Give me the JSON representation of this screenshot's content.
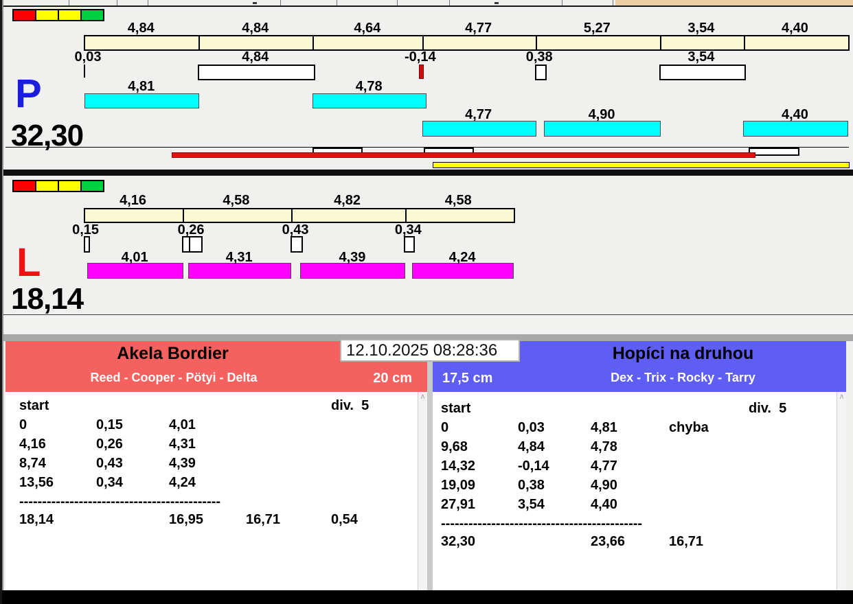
{
  "clock": {
    "datetime": "12.10.2025 08:28:36"
  },
  "race_panels": [
    {
      "letter": "P",
      "letter_color": "#1c1cdc",
      "total": "32,30",
      "traffic_colors": [
        "#ff0000",
        "#ffff00",
        "#ffff00",
        "#00cf3f"
      ],
      "bar_color": "#00ffff",
      "segments": [
        {
          "label": "4,84",
          "value": 4.84
        },
        {
          "label": "4,84",
          "value": 4.84
        },
        {
          "label": "4,64",
          "value": 4.64
        },
        {
          "label": "4,77",
          "value": 4.77
        },
        {
          "label": "5,27",
          "value": 5.27
        },
        {
          "label": "3,54",
          "value": 3.54
        },
        {
          "label": "4,40",
          "value": 4.4
        }
      ],
      "crossings": [
        {
          "label": "0,03",
          "value": 0.03,
          "at": 0,
          "style": "tick"
        },
        {
          "label": "4,84",
          "value": 4.84,
          "at": 4.84,
          "style": "box"
        },
        {
          "label": "-0,14",
          "value": 0.14,
          "at": 14.18,
          "style": "negative"
        },
        {
          "label": "0,38",
          "value": 0.38,
          "at": 19.09,
          "style": "box"
        },
        {
          "label": "3,54",
          "value": 3.54,
          "at": 24.36,
          "style": "box"
        }
      ],
      "dog_times": [
        {
          "label": "4,81",
          "value": 4.81,
          "at": 0.03,
          "row": 0
        },
        {
          "label": "4,78",
          "value": 4.78,
          "at": 9.68,
          "row": 0
        },
        {
          "label": "4,77",
          "value": 4.77,
          "at": 14.32,
          "row": 1
        },
        {
          "label": "4,90",
          "value": 4.9,
          "at": 19.47,
          "row": 1
        },
        {
          "label": "4,40",
          "value": 4.4,
          "at": 27.9,
          "row": 1
        }
      ],
      "marks": {
        "white_boxes": [
          [
            447,
            69
          ],
          [
            609,
            69
          ],
          [
            1082,
            70
          ]
        ],
        "red_bar": [
          242,
          850
        ],
        "yellow_bar": [
          622,
          607
        ]
      }
    },
    {
      "letter": "L",
      "letter_color": "#ee1212",
      "total": "18,14",
      "traffic_colors": [
        "#ff0000",
        "#ffff00",
        "#ffff00",
        "#00cf3f"
      ],
      "bar_color": "#ff00ff",
      "segments": [
        {
          "label": "4,16",
          "value": 4.16
        },
        {
          "label": "4,58",
          "value": 4.58
        },
        {
          "label": "4,82",
          "value": 4.82
        },
        {
          "label": "4,58",
          "value": 4.58
        }
      ],
      "crossings": [
        {
          "label": "0,15",
          "value": 0.15,
          "at": 0,
          "style": "box"
        },
        {
          "label": "0,26",
          "value": 0.26,
          "at": 4.16,
          "style": "box",
          "cells": 2
        },
        {
          "label": "0,43",
          "value": 0.43,
          "at": 8.74,
          "style": "box"
        },
        {
          "label": "0,34",
          "value": 0.34,
          "at": 13.56,
          "style": "box"
        }
      ],
      "dog_times": [
        {
          "label": "4,01",
          "value": 4.01,
          "at": 0.15,
          "row": 0
        },
        {
          "label": "4,31",
          "value": 4.31,
          "at": 4.42,
          "row": 0
        },
        {
          "label": "4,39",
          "value": 4.39,
          "at": 9.17,
          "row": 0
        },
        {
          "label": "4,24",
          "value": 4.24,
          "at": 13.9,
          "row": 0
        }
      ],
      "marks": null
    }
  ],
  "teams": [
    {
      "name": "Akela Bordier",
      "dogs": "Reed - Cooper - Pötyi - Delta",
      "jump_height": "20 cm",
      "header_color": "#f5615e",
      "table": {
        "start_label": "start",
        "div_label": "div.  5",
        "rows": [
          [
            "0",
            "0,15",
            "4,01",
            ""
          ],
          [
            "4,16",
            "0,26",
            "4,31",
            ""
          ],
          [
            "8,74",
            "0,43",
            "4,39",
            ""
          ],
          [
            "13,56",
            "0,34",
            "4,24",
            ""
          ]
        ],
        "separator": "--------------------------------------------",
        "totals": [
          "18,14",
          "",
          "16,95",
          "16,71",
          "0,54"
        ]
      }
    },
    {
      "name": "Hopíci na druhou",
      "dogs": "Dex - Trix - Rocky - Tarry",
      "jump_height": "17,5 cm",
      "header_color": "#5e5ef5",
      "table": {
        "start_label": "start",
        "div_label": "div.  5",
        "rows": [
          [
            "0",
            "0,03",
            "4,81",
            "chyba"
          ],
          [
            "9,68",
            "4,84",
            "4,78",
            ""
          ],
          [
            "14,32",
            "-0,14",
            "4,77",
            ""
          ],
          [
            "19,09",
            "0,38",
            "4,90",
            ""
          ],
          [
            "27,91",
            "3,54",
            "4,40",
            ""
          ]
        ],
        "separator": "--------------------------------------------",
        "totals": [
          "32,30",
          "",
          "23,66",
          "16,71",
          ""
        ]
      }
    }
  ]
}
